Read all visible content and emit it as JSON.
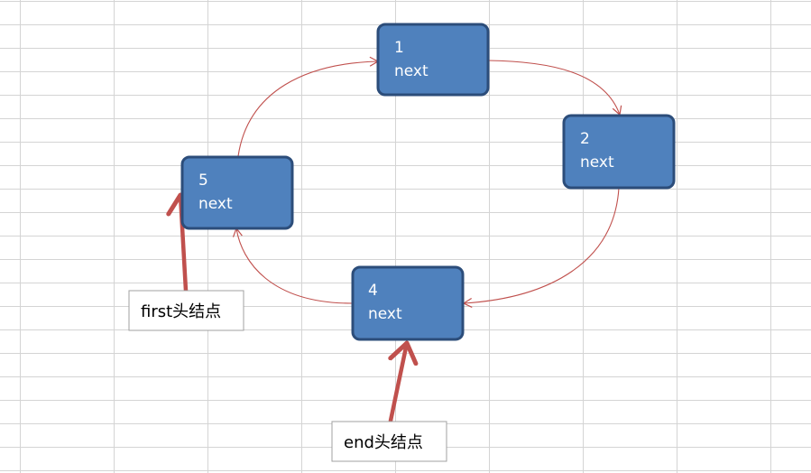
{
  "nodes": [
    {
      "id": "1",
      "value": "1",
      "field": "next"
    },
    {
      "id": "2",
      "value": "2",
      "field": "next"
    },
    {
      "id": "4",
      "value": "4",
      "field": "next"
    },
    {
      "id": "5",
      "value": "5",
      "field": "next"
    }
  ],
  "labels": {
    "first": "first头结点",
    "end": "end头结点"
  },
  "colors": {
    "node_fill": "#4f81bd",
    "node_border": "#2c4d7a",
    "edge": "#c0504d",
    "pointer": "#c0504d",
    "label_border": "#a0a0a0"
  },
  "edges": [
    {
      "from": "1",
      "to": "2"
    },
    {
      "from": "2",
      "to": "4"
    },
    {
      "from": "4",
      "to": "5"
    },
    {
      "from": "5",
      "to": "1"
    }
  ],
  "pointers": [
    {
      "label": "first",
      "target": "5"
    },
    {
      "label": "end",
      "target": "4"
    }
  ]
}
